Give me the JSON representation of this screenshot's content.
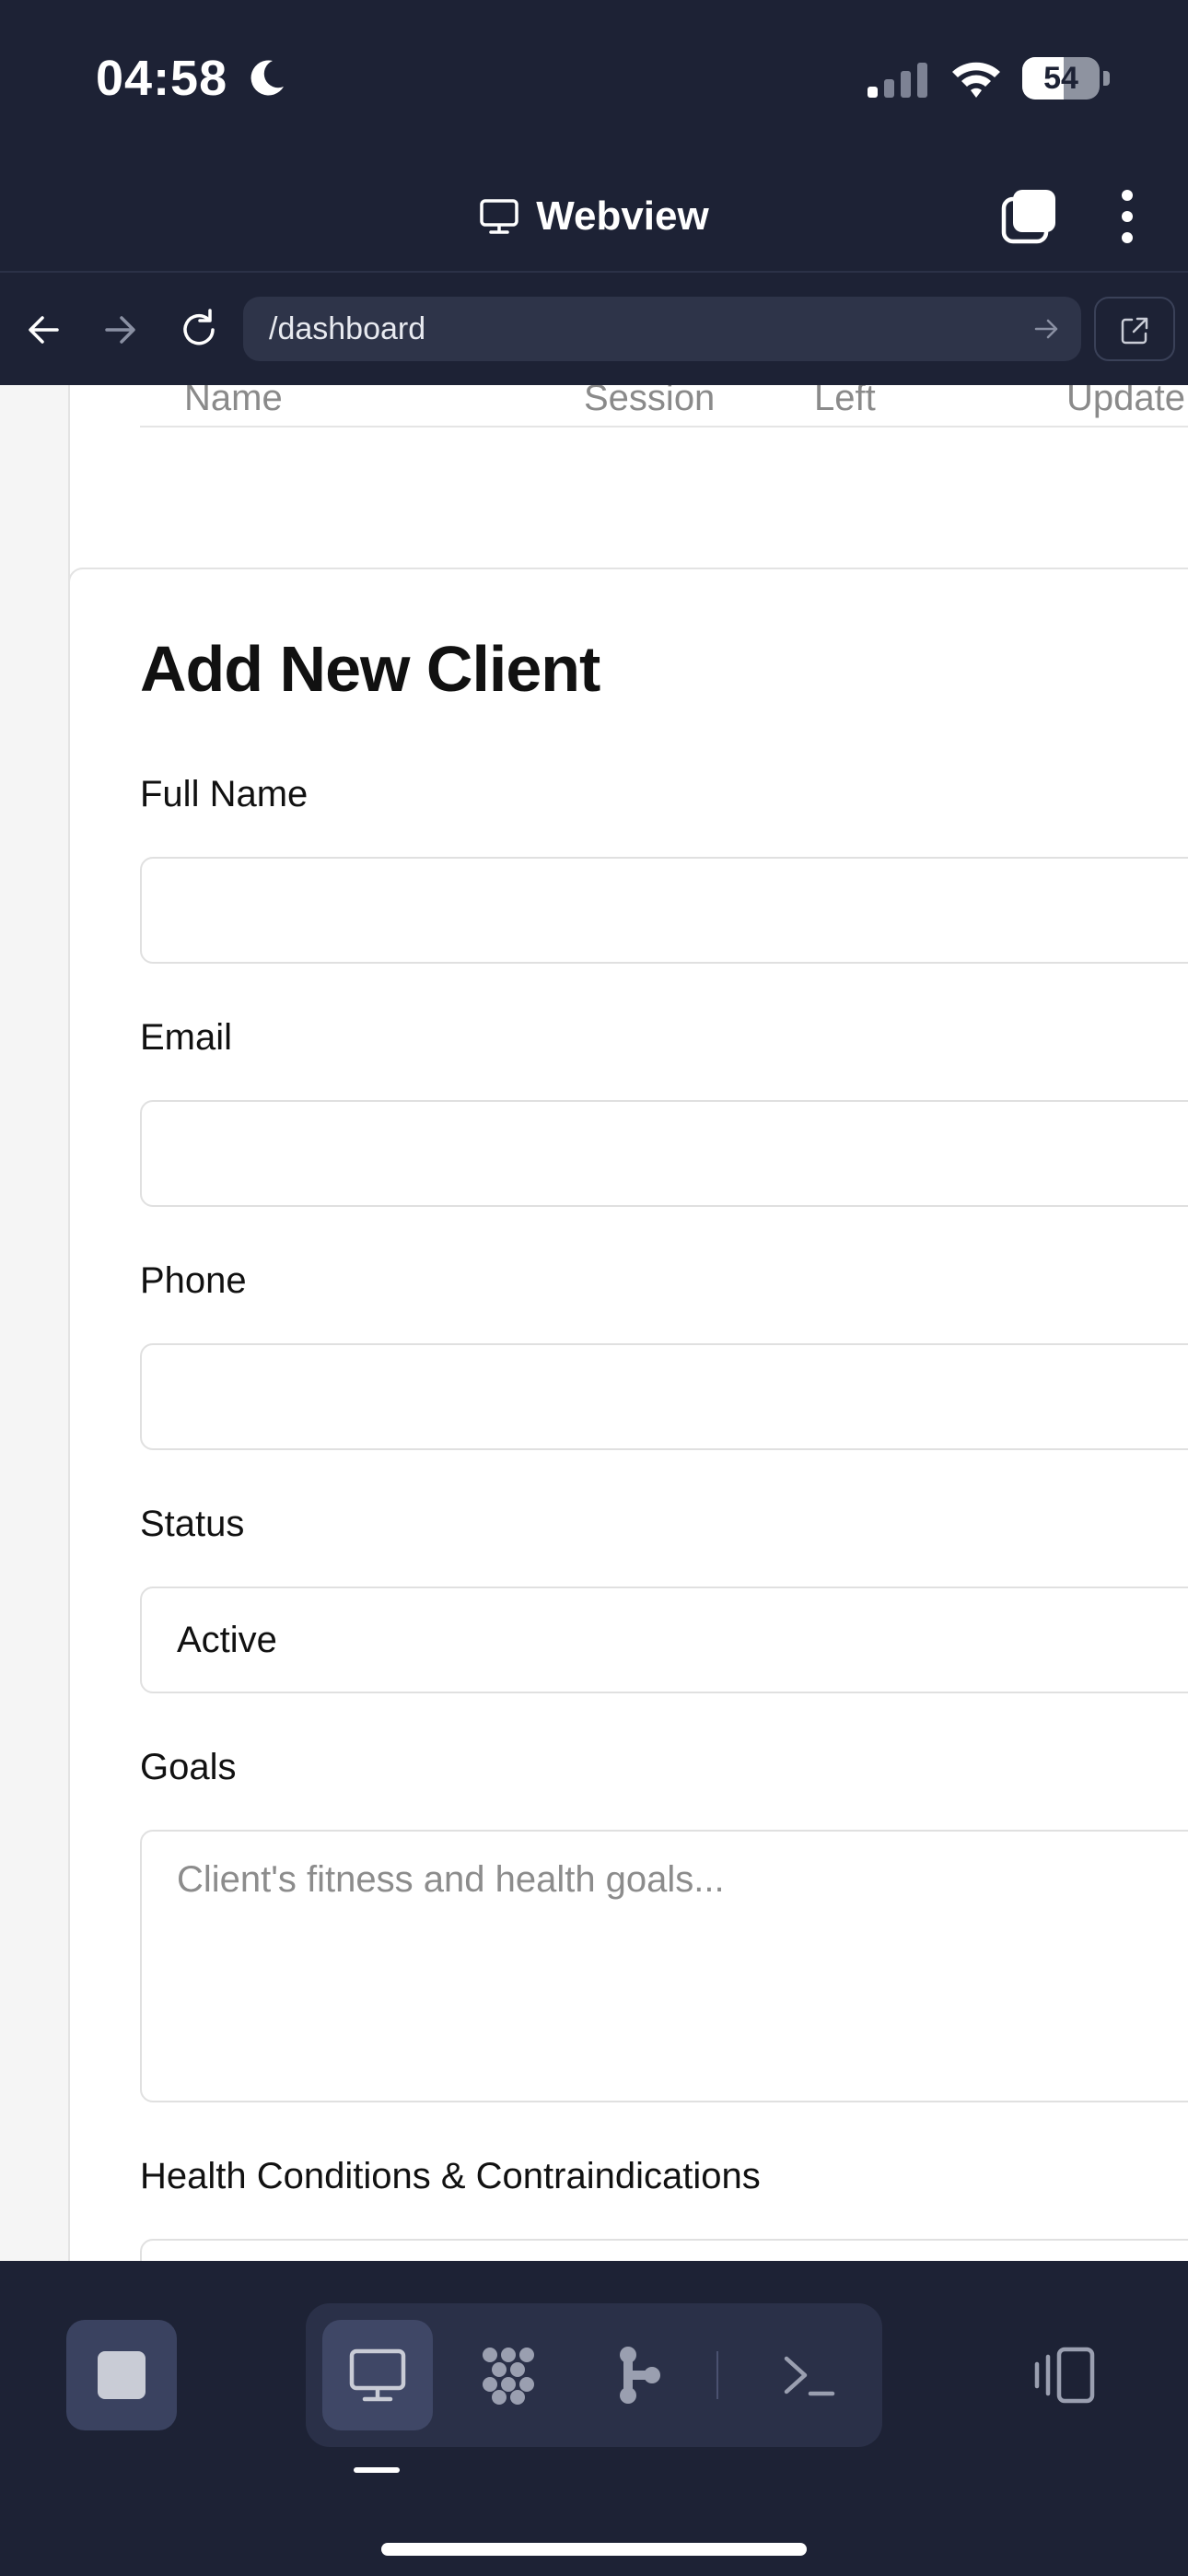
{
  "status_bar": {
    "time": "04:58",
    "battery_percent": "54",
    "battery_level": 0.54
  },
  "header": {
    "title": "Webview"
  },
  "url_bar": {
    "url": "/dashboard"
  },
  "previous_table": {
    "columns": [
      "Name",
      "Session",
      "Left",
      "Update"
    ]
  },
  "form": {
    "title": "Add New Client",
    "fields": {
      "full_name": {
        "label": "Full Name",
        "value": ""
      },
      "email": {
        "label": "Email",
        "value": ""
      },
      "phone": {
        "label": "Phone",
        "value": ""
      },
      "status": {
        "label": "Status",
        "value": "Active"
      },
      "goals": {
        "label": "Goals",
        "placeholder": "Client's fitness and health goals..."
      },
      "health": {
        "label": "Health Conditions & Contraindications"
      }
    }
  },
  "toolbar": {
    "modes": [
      "monitor-icon",
      "grid-dots-icon",
      "branch-icon",
      "terminal-icon"
    ],
    "active_mode": "monitor-icon"
  },
  "colors": {
    "chrome": "#1d2235",
    "content_bg": "#f5f5f5",
    "accent": "#3f4766"
  }
}
